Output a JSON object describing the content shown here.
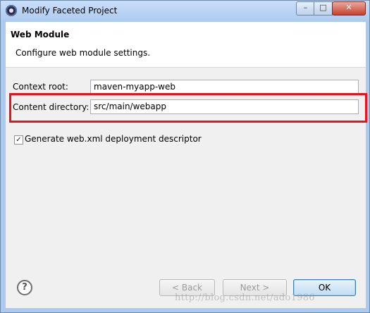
{
  "window": {
    "title": "Modify Faceted Project",
    "minimize_glyph": "–",
    "maximize_glyph": "□",
    "close_glyph": "✕"
  },
  "banner": {
    "title": "Web Module",
    "description": "Configure web module settings."
  },
  "form": {
    "context_root_label": "Context root:",
    "context_root_value": "maven-myapp-web",
    "content_directory_label": "Content directory:",
    "content_directory_value": "src/main/webapp",
    "generate_descriptor_label": "Generate web.xml deployment descriptor",
    "generate_descriptor_checked": true
  },
  "buttons": {
    "help_glyph": "?",
    "back_label": "< Back",
    "next_label": "Next >",
    "ok_label": "OK"
  },
  "watermark": "http://blog.csdn.net/ado1986",
  "colors": {
    "highlight_border": "#e8131b",
    "titlebar": "#aecbee"
  }
}
